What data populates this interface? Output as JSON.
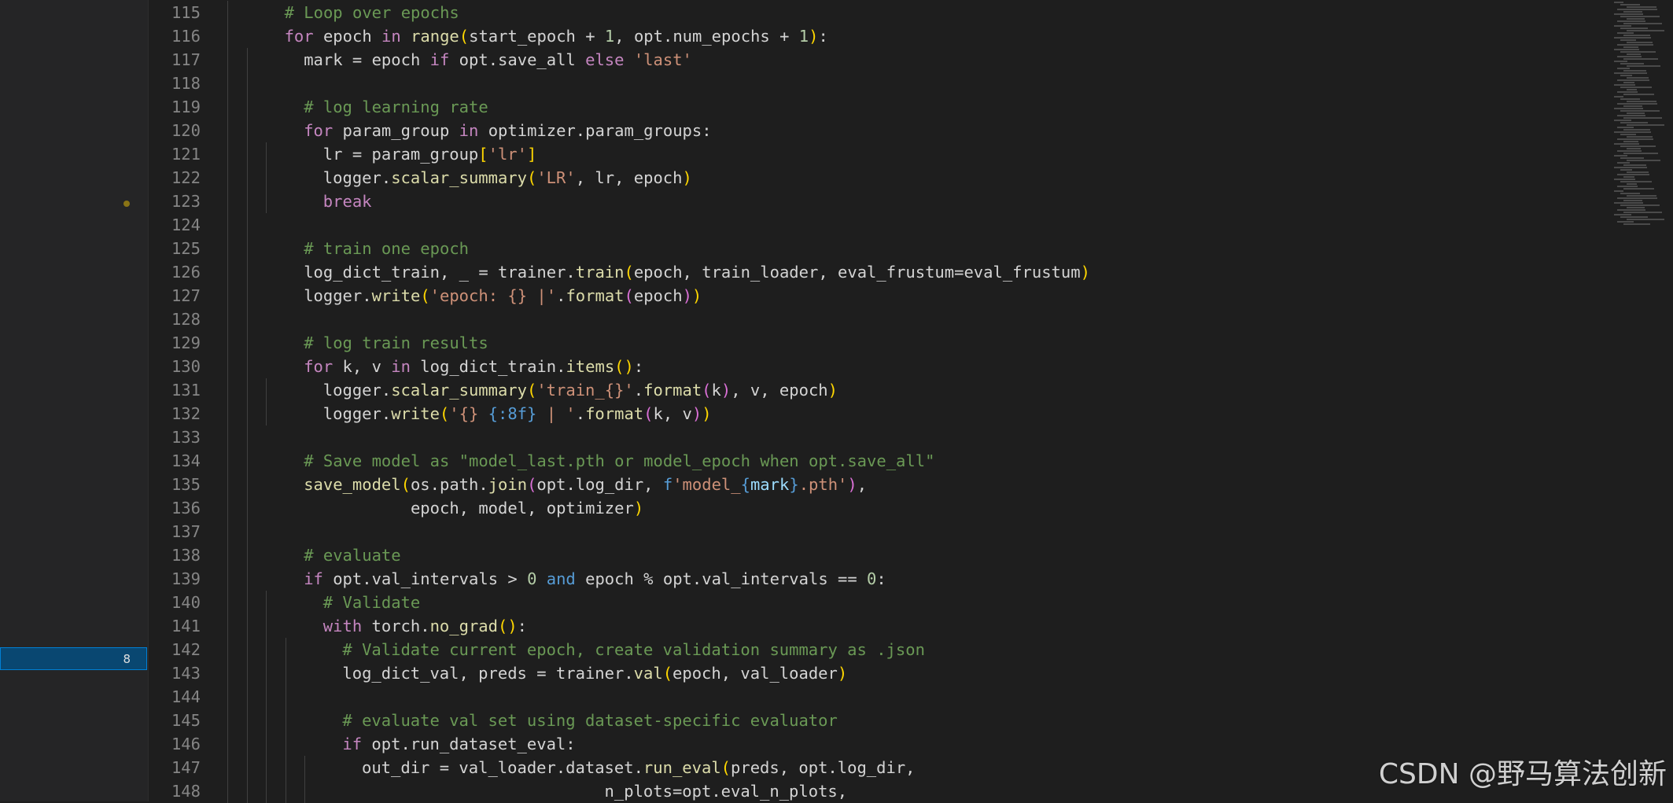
{
  "side_panel": {
    "badge": "8"
  },
  "lines": [
    {
      "n": "115",
      "indent": 1,
      "segments": [
        [
          "com",
          "# Loop over epochs"
        ]
      ]
    },
    {
      "n": "116",
      "indent": 1,
      "segments": [
        [
          "ctl",
          "for"
        ],
        [
          "",
          " epoch "
        ],
        [
          "ctl",
          "in"
        ],
        [
          "",
          " "
        ],
        [
          "fn",
          "range"
        ],
        [
          "b1",
          "("
        ],
        [
          "",
          "start_epoch + "
        ],
        [
          "num",
          "1"
        ],
        [
          "",
          ", opt.num_epochs + "
        ],
        [
          "num",
          "1"
        ],
        [
          "b1",
          ")"
        ],
        [
          "",
          ":"
        ]
      ]
    },
    {
      "n": "117",
      "indent": 2,
      "segments": [
        [
          "",
          "mark = epoch "
        ],
        [
          "ctl",
          "if"
        ],
        [
          "",
          " opt.save_all "
        ],
        [
          "ctl",
          "else"
        ],
        [
          "",
          " "
        ],
        [
          "str",
          "'last'"
        ]
      ]
    },
    {
      "n": "118",
      "indent": 2,
      "segments": []
    },
    {
      "n": "119",
      "indent": 2,
      "segments": [
        [
          "com",
          "# log learning rate"
        ]
      ]
    },
    {
      "n": "120",
      "indent": 2,
      "segments": [
        [
          "ctl",
          "for"
        ],
        [
          "",
          " param_group "
        ],
        [
          "ctl",
          "in"
        ],
        [
          "",
          " optimizer.param_groups:"
        ]
      ]
    },
    {
      "n": "121",
      "indent": 3,
      "segments": [
        [
          "",
          "lr = param_group"
        ],
        [
          "b1",
          "["
        ],
        [
          "str",
          "'lr'"
        ],
        [
          "b1",
          "]"
        ]
      ]
    },
    {
      "n": "122",
      "indent": 3,
      "segments": [
        [
          "",
          "logger."
        ],
        [
          "fn",
          "scalar_summary"
        ],
        [
          "b1",
          "("
        ],
        [
          "str",
          "'LR'"
        ],
        [
          "",
          ", lr, epoch"
        ],
        [
          "b1",
          ")"
        ]
      ]
    },
    {
      "n": "123",
      "indent": 3,
      "segments": [
        [
          "ctl",
          "break"
        ]
      ]
    },
    {
      "n": "124",
      "indent": 2,
      "segments": []
    },
    {
      "n": "125",
      "indent": 2,
      "segments": [
        [
          "com",
          "# train one epoch"
        ]
      ]
    },
    {
      "n": "126",
      "indent": 2,
      "segments": [
        [
          "",
          "log_dict_train, _ = trainer."
        ],
        [
          "fn",
          "train"
        ],
        [
          "b1",
          "("
        ],
        [
          "",
          "epoch, train_loader, eval_frustum=eval_frustum"
        ],
        [
          "b1",
          ")"
        ]
      ]
    },
    {
      "n": "127",
      "indent": 2,
      "segments": [
        [
          "",
          "logger."
        ],
        [
          "fn",
          "write"
        ],
        [
          "b1",
          "("
        ],
        [
          "str",
          "'epoch: {} |'"
        ],
        [
          "",
          "."
        ],
        [
          "fn",
          "format"
        ],
        [
          "b2",
          "("
        ],
        [
          "",
          "epoch"
        ],
        [
          "b2",
          ")"
        ],
        [
          "b1",
          ")"
        ]
      ]
    },
    {
      "n": "128",
      "indent": 2,
      "segments": []
    },
    {
      "n": "129",
      "indent": 2,
      "segments": [
        [
          "com",
          "# log train results"
        ]
      ]
    },
    {
      "n": "130",
      "indent": 2,
      "segments": [
        [
          "ctl",
          "for"
        ],
        [
          "",
          " k, v "
        ],
        [
          "ctl",
          "in"
        ],
        [
          "",
          " log_dict_train."
        ],
        [
          "fn",
          "items"
        ],
        [
          "b1",
          "()"
        ],
        [
          "",
          ":"
        ]
      ]
    },
    {
      "n": "131",
      "indent": 3,
      "segments": [
        [
          "",
          "logger."
        ],
        [
          "fn",
          "scalar_summary"
        ],
        [
          "b1",
          "("
        ],
        [
          "str",
          "'train_{}'"
        ],
        [
          "",
          "."
        ],
        [
          "fn",
          "format"
        ],
        [
          "b2",
          "("
        ],
        [
          "",
          "k"
        ],
        [
          "b2",
          ")"
        ],
        [
          "",
          ", v, epoch"
        ],
        [
          "b1",
          ")"
        ]
      ]
    },
    {
      "n": "132",
      "indent": 3,
      "segments": [
        [
          "",
          "logger."
        ],
        [
          "fn",
          "write"
        ],
        [
          "b1",
          "("
        ],
        [
          "str",
          "'{} "
        ],
        [
          "kw",
          "{:8f}"
        ],
        [
          "str",
          " | '"
        ],
        [
          "",
          "."
        ],
        [
          "fn",
          "format"
        ],
        [
          "b2",
          "("
        ],
        [
          "",
          "k, v"
        ],
        [
          "b2",
          ")"
        ],
        [
          "b1",
          ")"
        ]
      ]
    },
    {
      "n": "133",
      "indent": 2,
      "segments": []
    },
    {
      "n": "134",
      "indent": 2,
      "segments": [
        [
          "com",
          "# Save model as \"model_last.pth or model_epoch when opt.save_all\""
        ]
      ]
    },
    {
      "n": "135",
      "indent": 2,
      "segments": [
        [
          "fn",
          "save_model"
        ],
        [
          "b1",
          "("
        ],
        [
          "",
          "os.path."
        ],
        [
          "fn",
          "join"
        ],
        [
          "b2",
          "("
        ],
        [
          "",
          "opt.log_dir, "
        ],
        [
          "kw",
          "f"
        ],
        [
          "str",
          "'model_"
        ],
        [
          "kw",
          "{"
        ],
        [
          "var",
          "mark"
        ],
        [
          "kw",
          "}"
        ],
        [
          "str",
          ".pth'"
        ],
        [
          "b2",
          ")"
        ],
        [
          "",
          ","
        ]
      ]
    },
    {
      "n": "136",
      "indent": 2,
      "segments": [
        [
          "",
          "           epoch, model, optimizer"
        ],
        [
          "b1",
          ")"
        ]
      ]
    },
    {
      "n": "137",
      "indent": 2,
      "segments": []
    },
    {
      "n": "138",
      "indent": 2,
      "segments": [
        [
          "com",
          "# evaluate"
        ]
      ]
    },
    {
      "n": "139",
      "indent": 2,
      "segments": [
        [
          "ctl",
          "if"
        ],
        [
          "",
          " opt.val_intervals > "
        ],
        [
          "num",
          "0"
        ],
        [
          "",
          " "
        ],
        [
          "kw",
          "and"
        ],
        [
          "",
          " epoch % opt.val_intervals == "
        ],
        [
          "num",
          "0"
        ],
        [
          "",
          ":"
        ]
      ]
    },
    {
      "n": "140",
      "indent": 3,
      "segments": [
        [
          "com",
          "# Validate"
        ]
      ]
    },
    {
      "n": "141",
      "indent": 3,
      "segments": [
        [
          "ctl",
          "with"
        ],
        [
          "",
          " torch."
        ],
        [
          "fn",
          "no_grad"
        ],
        [
          "b1",
          "()"
        ],
        [
          "",
          ":"
        ]
      ]
    },
    {
      "n": "142",
      "indent": 4,
      "segments": [
        [
          "com",
          "# Validate current epoch, create validation summary as .json"
        ]
      ]
    },
    {
      "n": "143",
      "indent": 4,
      "segments": [
        [
          "",
          "log_dict_val, preds = trainer."
        ],
        [
          "fn",
          "val"
        ],
        [
          "b1",
          "("
        ],
        [
          "",
          "epoch, val_loader"
        ],
        [
          "b1",
          ")"
        ]
      ]
    },
    {
      "n": "144",
      "indent": 4,
      "segments": []
    },
    {
      "n": "145",
      "indent": 4,
      "segments": [
        [
          "com",
          "# evaluate val set using dataset-specific evaluator"
        ]
      ]
    },
    {
      "n": "146",
      "indent": 4,
      "segments": [
        [
          "ctl",
          "if"
        ],
        [
          "",
          " opt.run_dataset_eval:"
        ]
      ]
    },
    {
      "n": "147",
      "indent": 5,
      "segments": [
        [
          "",
          "out_dir = val_loader.dataset."
        ],
        [
          "fn",
          "run_eval"
        ],
        [
          "b1",
          "("
        ],
        [
          "",
          "preds, opt.log_dir,"
        ]
      ]
    },
    {
      "n": "148",
      "indent": 5,
      "segments": [
        [
          "",
          "                         n_plots=opt.eval_n_plots,"
        ]
      ]
    }
  ],
  "watermark": "CSDN @野马算法创新"
}
